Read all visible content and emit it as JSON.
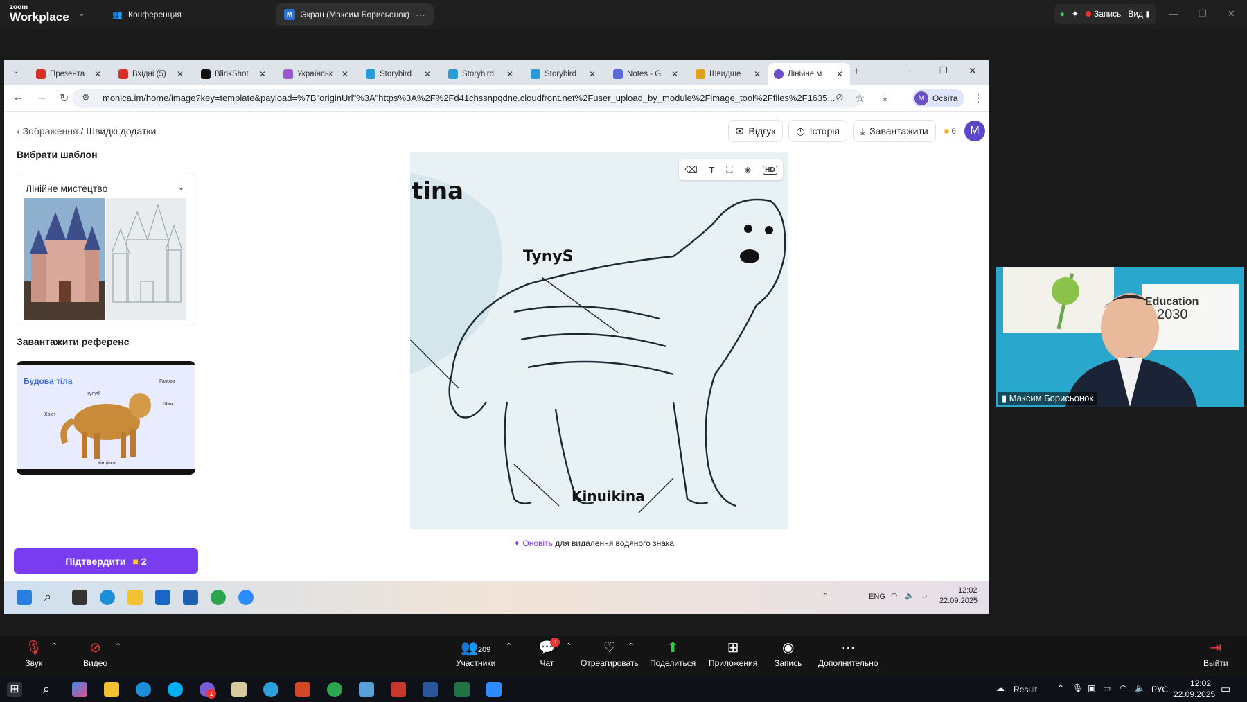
{
  "zoom": {
    "logo_line1": "zoom",
    "logo_line2": "Workplace",
    "tab_conference": "Конференция",
    "tab_screen": "Экран (Максим Борисьонок)",
    "screen_badge": "M",
    "record_label": "Запись",
    "view_label": "Вид"
  },
  "browser": {
    "tabs": [
      {
        "label": "Презента",
        "color": "#d93025"
      },
      {
        "label": "Вхідні (5)",
        "color": "#d93025"
      },
      {
        "label": "BlinkShot",
        "color": "#111111"
      },
      {
        "label": "Українськ",
        "color": "#9b59d0"
      },
      {
        "label": "Storybird",
        "color": "#2a9bd6"
      },
      {
        "label": "Storybird",
        "color": "#2a9bd6"
      },
      {
        "label": "Storybird",
        "color": "#2a9bd6"
      },
      {
        "label": "Notes - G",
        "color": "#5b6bd6"
      },
      {
        "label": "Швидше",
        "color": "#e0a020"
      },
      {
        "label": "Лінійне м",
        "color": "#6b4fc8"
      }
    ],
    "url": "monica.im/home/image?key=template&payload=%7B\"originUrl\"%3A\"https%3A%2F%2Fd41chssnpqdne.cloudfront.net%2Fuser_upload_by_module%2Fimage_tool%2Ffiles%2F1635...",
    "profile_initial": "M",
    "profile_label": "Освіта"
  },
  "sidebar": {
    "breadcrumb_parent": "Зображення",
    "breadcrumb_current": "/ Швидкі додатки",
    "choose_template_label": "Вибрати шаблон",
    "template_name": "Лінійне мистецтво",
    "upload_reference_label": "Завантажити референс",
    "reference": {
      "title": "Будова тіла",
      "labels": [
        "Голова",
        "Тулуб",
        "Шия",
        "Хвіст",
        "Кінцівки"
      ]
    },
    "confirm_label": "Підтвердити",
    "confirm_credits": "2"
  },
  "main": {
    "feedback_label": "Відгук",
    "history_label": "Історія",
    "download_label": "Завантажити",
    "credits": "6",
    "user_initial": "M",
    "image_words": {
      "title": "tina",
      "torso": "TynyS",
      "limbs": "Kinuikina"
    },
    "watermark_cta": "Оновіть",
    "watermark_text": "для видалення водяного знака"
  },
  "taskbar": {
    "lang": "ENG",
    "time": "12:02",
    "date": "22.09.2025"
  },
  "zoom_controls": {
    "audio": "Звук",
    "video": "Видео",
    "participants": "Участники",
    "participants_count": "209",
    "chat": "Чат",
    "chat_badge": "3",
    "react": "Отреагировать",
    "share": "Поделиться",
    "apps": "Приложения",
    "record": "Запись",
    "more": "Дополнительно",
    "leave": "Выйти"
  },
  "video": {
    "name": "Максим Борисьонок",
    "poster_line1": "Education",
    "poster_line2": "2030"
  },
  "windows": {
    "result_label": "Result",
    "lang": "РУС",
    "time": "12:02",
    "date": "22.09.2025",
    "badge_one": "1"
  }
}
